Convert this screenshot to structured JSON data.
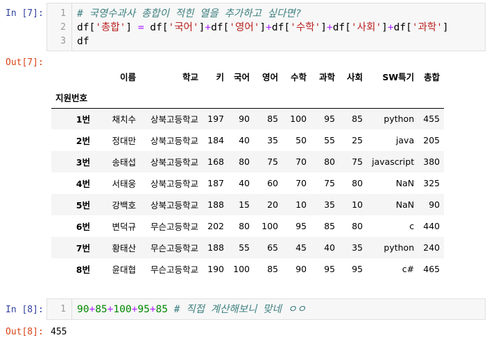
{
  "cells": {
    "in7_prompt": "In [7]:",
    "in7_linenos": [
      "1",
      "2",
      "3"
    ],
    "in7_line1": "# 국영수과사 총합이 적힌 열을 추가하고 싶다면?",
    "in7_line2": {
      "t1": "df[",
      "s1": "'총합'",
      "t2": "] ",
      "op1": "=",
      "t3": " df[",
      "s2": "'국어'",
      "t4": "]",
      "op2": "+",
      "t5": "df[",
      "s3": "'영어'",
      "t6": "]",
      "op3": "+",
      "t7": "df[",
      "s4": "'수학'",
      "t8": "]",
      "op4": "+",
      "t9": "df[",
      "s5": "'사회'",
      "t10": "]",
      "op5": "+",
      "t11": "df[",
      "s6": "'과학'",
      "t12": "]"
    },
    "in7_line3": "df",
    "out7_prompt": "Out[7]:",
    "in8_prompt": "In [8]:",
    "in8_lineno": "1",
    "in8_line1": {
      "n1": "90",
      "p1": "+",
      "n2": "85",
      "p2": "+",
      "n3": "100",
      "p3": "+",
      "n4": "95",
      "p4": "+",
      "n5": "85",
      "comment": " # 직접 계산해보니 맞네 ㅇㅇ"
    },
    "out8_prompt": "Out[8]:",
    "out8_value": "455"
  },
  "dataframe": {
    "columns": [
      "이름",
      "학교",
      "키",
      "국어",
      "영어",
      "수학",
      "과학",
      "사회",
      "SW특기",
      "총합"
    ],
    "index_name": "지원번호",
    "rows": [
      {
        "index": "1번",
        "cells": [
          "채치수",
          "상북고등학교",
          "197",
          "90",
          "85",
          "100",
          "95",
          "85",
          "python",
          "455"
        ]
      },
      {
        "index": "2번",
        "cells": [
          "정대만",
          "상북고등학교",
          "184",
          "40",
          "35",
          "50",
          "55",
          "25",
          "java",
          "205"
        ]
      },
      {
        "index": "3번",
        "cells": [
          "송태섭",
          "상북고등학교",
          "168",
          "80",
          "75",
          "70",
          "80",
          "75",
          "javascript",
          "380"
        ]
      },
      {
        "index": "4번",
        "cells": [
          "서태웅",
          "상북고등학교",
          "187",
          "40",
          "60",
          "70",
          "75",
          "80",
          "NaN",
          "325"
        ]
      },
      {
        "index": "5번",
        "cells": [
          "강백호",
          "상북고등학교",
          "188",
          "15",
          "20",
          "10",
          "35",
          "10",
          "NaN",
          "90"
        ]
      },
      {
        "index": "6번",
        "cells": [
          "변덕규",
          "무슨고등학교",
          "202",
          "80",
          "100",
          "95",
          "85",
          "80",
          "c",
          "440"
        ]
      },
      {
        "index": "7번",
        "cells": [
          "황태산",
          "무슨고등학교",
          "188",
          "55",
          "65",
          "45",
          "40",
          "35",
          "python",
          "240"
        ]
      },
      {
        "index": "8번",
        "cells": [
          "윤대협",
          "무슨고등학교",
          "190",
          "100",
          "85",
          "90",
          "95",
          "95",
          "c#",
          "465"
        ]
      }
    ]
  }
}
